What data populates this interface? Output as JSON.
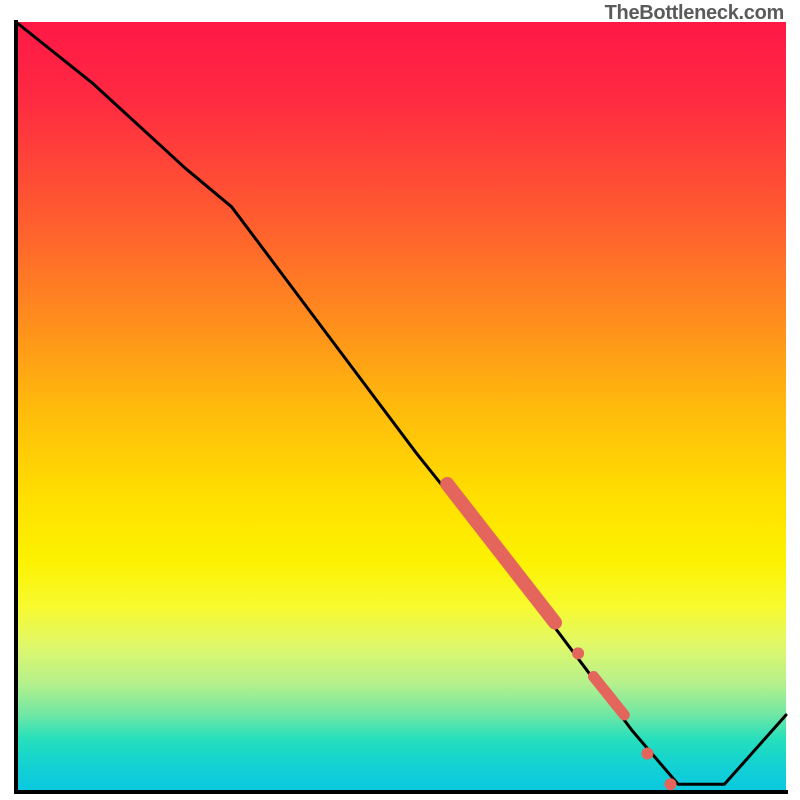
{
  "watermark": "TheBottleneck.com",
  "chart_data": {
    "type": "line",
    "title": "",
    "xlabel": "",
    "ylabel": "",
    "legend": false,
    "grid": false,
    "x_range": [
      0,
      100
    ],
    "y_range": [
      0,
      100
    ],
    "series": [
      {
        "name": "bottleneck-curve",
        "color": "#000000",
        "x": [
          0,
          10,
          22,
          28,
          40,
          52,
          60,
          68,
          74,
          80,
          86,
          92,
          100
        ],
        "y": [
          100,
          92,
          81,
          76,
          60,
          44,
          34,
          24,
          16,
          8,
          1,
          1,
          10
        ]
      }
    ],
    "highlights": [
      {
        "name": "thick-red-segment",
        "color": "#e3655c",
        "width": 12,
        "x": [
          56,
          70
        ],
        "y": [
          40,
          22
        ]
      },
      {
        "name": "red-dot-1",
        "color": "#e3655c",
        "radius": 6,
        "x": 73,
        "y": 18
      },
      {
        "name": "red-short-segment",
        "color": "#e3655c",
        "width": 10,
        "x": [
          75,
          79
        ],
        "y": [
          15,
          10
        ]
      },
      {
        "name": "red-dot-2",
        "color": "#e3655c",
        "radius": 6,
        "x": 82,
        "y": 5
      },
      {
        "name": "red-dot-3",
        "color": "#e3655c",
        "radius": 6,
        "x": 85,
        "y": 1
      }
    ],
    "background_gradient": {
      "top": "#ff1846",
      "bottom": "#0ac8e0"
    }
  }
}
